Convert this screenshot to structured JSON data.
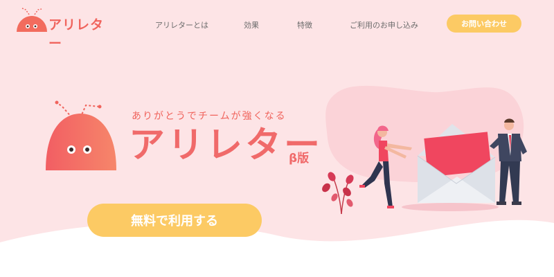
{
  "header": {
    "logo_text": "アリレター",
    "nav": [
      {
        "label": "アリレターとは"
      },
      {
        "label": "効果"
      },
      {
        "label": "特徴"
      },
      {
        "label": "ご利用のお申し込み"
      }
    ],
    "contact_label": "お問い合わせ"
  },
  "hero": {
    "tagline": "ありがとうでチームが強くなる",
    "title": "アリレター",
    "badge": "β版",
    "cta_label": "無料で利用する"
  },
  "icons": {
    "logo": "ant-mascot-icon",
    "hero_mascot": "ant-mascot-icon",
    "illustration": "letter-exchange-illustration"
  },
  "colors": {
    "background": "#fde4e6",
    "brand": "#f0645d",
    "accent": "#fcca64",
    "nav_text": "#6c6c6c"
  }
}
